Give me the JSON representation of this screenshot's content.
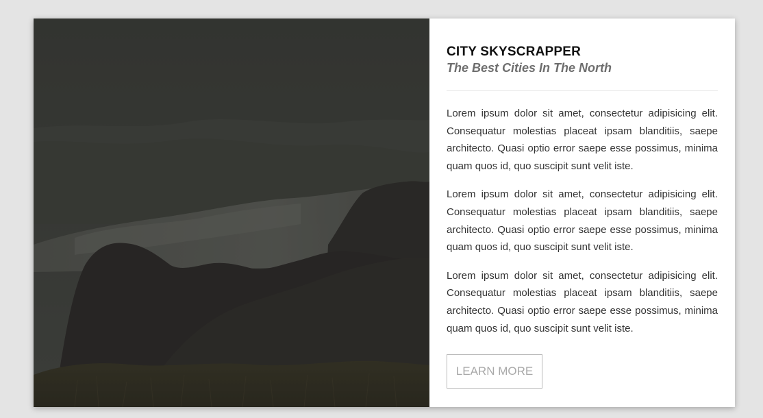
{
  "card": {
    "title": "CITY SKYSCRAPPER",
    "subtitle": "The Best Cities In The North",
    "paragraphs": [
      "Lorem ipsum dolor sit amet, consectetur adipisicing elit. Consequatur molestias placeat ipsam blanditiis, saepe architecto. Quasi optio error saepe esse possimus, minima quam quos id, quo suscipit sunt velit iste.",
      "Lorem ipsum dolor sit amet, consectetur adipisicing elit. Consequatur molestias placeat ipsam blanditiis, saepe architecto. Quasi optio error saepe esse possimus, minima quam quos id, quo suscipit sunt velit iste.",
      "Lorem ipsum dolor sit amet, consectetur adipisicing elit. Consequatur molestias placeat ipsam blanditiis, saepe architecto. Quasi optio error saepe esse possimus, minima quam quos id, quo suscipit sunt velit iste."
    ],
    "button_label": "LEARN MORE",
    "image_subject": "mountain-landscape-photo"
  },
  "colors": {
    "page_background": "#e4e4e4",
    "card_background": "#ffffff",
    "title": "#111111",
    "subtitle": "#6e6e6e",
    "body_text": "#333333",
    "button_text": "#a9a9a9",
    "button_border": "#b8b8b8",
    "image_overlay": "#2b2c29"
  }
}
